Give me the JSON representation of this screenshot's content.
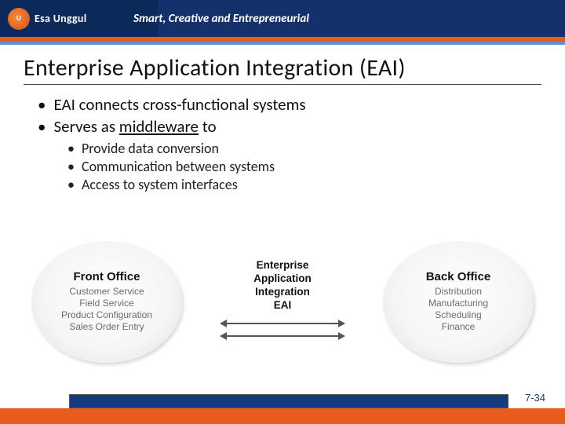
{
  "header": {
    "logo_text": "Esa Unggul",
    "tagline": "Smart, Creative and Entrepreneurial"
  },
  "title": "Enterprise Application Integration (EAI)",
  "bullets": {
    "b1": "EAI connects cross-functional systems",
    "b2_pre": "Serves as ",
    "b2_mid": "middleware",
    "b2_post": " to",
    "sub1": "Provide data conversion",
    "sub2": "Communication between systems",
    "sub3": "Access to system interfaces"
  },
  "diagram": {
    "front": {
      "title": "Front Office",
      "items": [
        "Customer Service",
        "Field Service",
        "Product Configuration",
        "Sales Order Entry"
      ]
    },
    "center": {
      "line1": "Enterprise",
      "line2": "Application",
      "line3": "Integration",
      "abbr": "EAI"
    },
    "back": {
      "title": "Back Office",
      "items": [
        "Distribution",
        "Manufacturing",
        "Scheduling",
        "Finance"
      ]
    }
  },
  "page_number": "7-34"
}
